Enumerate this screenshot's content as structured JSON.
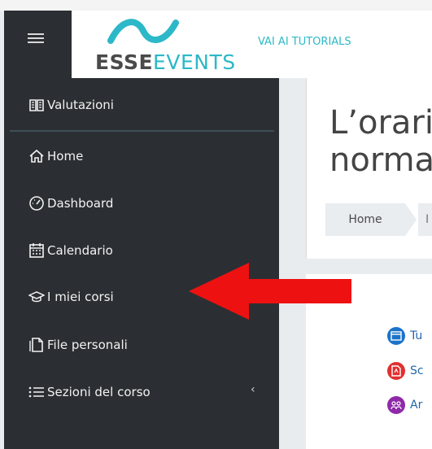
{
  "header": {
    "logo_bold": "ESSE",
    "logo_light": "EVENTS",
    "tutorials_link": "VAI AI TUTORIALS"
  },
  "sidebar": {
    "items": [
      {
        "label": "Valutazioni",
        "icon": "book-open-icon"
      },
      {
        "label": "Home",
        "icon": "home-icon"
      },
      {
        "label": "Dashboard",
        "icon": "gauge-icon"
      },
      {
        "label": "Calendario",
        "icon": "calendar-icon"
      },
      {
        "label": "I miei corsi",
        "icon": "graduation-cap-icon"
      },
      {
        "label": "File personali",
        "icon": "files-icon"
      },
      {
        "label": "Sezioni del corso",
        "icon": "list-icon"
      }
    ],
    "chevron": "‹"
  },
  "main": {
    "title_line1": "L’orari",
    "title_line2": "norma",
    "breadcrumb_home": "Home",
    "breadcrumb_next": "I",
    "resources": [
      {
        "label": "Tu",
        "color": "#1a73c9",
        "icon": "window-icon"
      },
      {
        "label": "Sc",
        "color": "#e03030",
        "icon": "pdf-icon"
      },
      {
        "label": "Ar",
        "color": "#8e2aa8",
        "icon": "users-icon"
      }
    ]
  },
  "colors": {
    "sidebar_bg": "#2b2f33",
    "brand_accent": "#2cb8c8",
    "annotation_arrow": "#ee1111"
  }
}
